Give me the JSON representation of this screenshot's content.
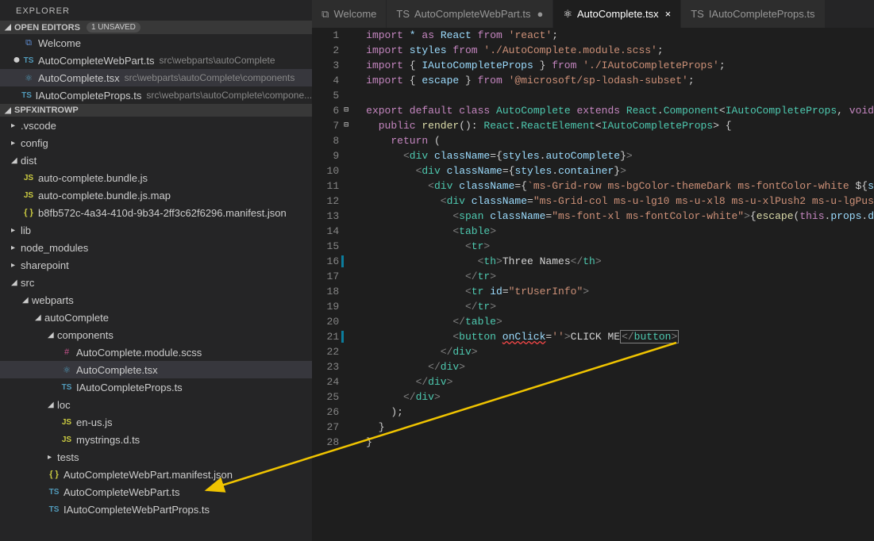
{
  "explorer": {
    "title": "EXPLORER",
    "openEditors": {
      "title": "OPEN EDITORS",
      "badge": "1 UNSAVED",
      "items": [
        {
          "icon": "vs",
          "label": "Welcome",
          "path": "",
          "dirty": false
        },
        {
          "icon": "ts",
          "label": "AutoCompleteWebPart.ts",
          "path": "src\\webparts\\autoComplete",
          "dirty": true
        },
        {
          "icon": "react",
          "label": "AutoComplete.tsx",
          "path": "src\\webparts\\autoComplete\\components",
          "dirty": false,
          "selected": true
        },
        {
          "icon": "ts",
          "label": "IAutoCompleteProps.ts",
          "path": "src\\webparts\\autoComplete\\compone...",
          "dirty": false
        }
      ]
    },
    "workspace": {
      "title": "SPFXINTROWP",
      "tree": [
        {
          "indent": 0,
          "type": "folder",
          "open": false,
          "label": ".vscode"
        },
        {
          "indent": 0,
          "type": "folder",
          "open": false,
          "label": "config"
        },
        {
          "indent": 0,
          "type": "folder",
          "open": true,
          "label": "dist"
        },
        {
          "indent": 1,
          "type": "file",
          "icon": "js",
          "label": "auto-complete.bundle.js"
        },
        {
          "indent": 1,
          "type": "file",
          "icon": "js",
          "label": "auto-complete.bundle.js.map"
        },
        {
          "indent": 1,
          "type": "file",
          "icon": "json",
          "label": "b8fb572c-4a34-410d-9b34-2ff3c62f6296.manifest.json"
        },
        {
          "indent": 0,
          "type": "folder",
          "open": false,
          "label": "lib"
        },
        {
          "indent": 0,
          "type": "folder",
          "open": false,
          "label": "node_modules"
        },
        {
          "indent": 0,
          "type": "folder",
          "open": false,
          "label": "sharepoint"
        },
        {
          "indent": 0,
          "type": "folder",
          "open": true,
          "label": "src"
        },
        {
          "indent": 1,
          "type": "folder",
          "open": true,
          "label": "webparts"
        },
        {
          "indent": 2,
          "type": "folder",
          "open": true,
          "label": "autoComplete"
        },
        {
          "indent": 3,
          "type": "folder",
          "open": true,
          "label": "components"
        },
        {
          "indent": 4,
          "type": "file",
          "icon": "scss",
          "label": "AutoComplete.module.scss"
        },
        {
          "indent": 4,
          "type": "file",
          "icon": "react",
          "label": "AutoComplete.tsx",
          "selected": true
        },
        {
          "indent": 4,
          "type": "file",
          "icon": "ts",
          "label": "IAutoCompleteProps.ts"
        },
        {
          "indent": 3,
          "type": "folder",
          "open": true,
          "label": "loc"
        },
        {
          "indent": 4,
          "type": "file",
          "icon": "js",
          "label": "en-us.js"
        },
        {
          "indent": 4,
          "type": "file",
          "icon": "js",
          "label": "mystrings.d.ts"
        },
        {
          "indent": 3,
          "type": "folder",
          "open": false,
          "label": "tests"
        },
        {
          "indent": 3,
          "type": "file",
          "icon": "json",
          "label": "AutoCompleteWebPart.manifest.json"
        },
        {
          "indent": 3,
          "type": "file",
          "icon": "ts",
          "label": "AutoCompleteWebPart.ts"
        },
        {
          "indent": 3,
          "type": "file",
          "icon": "ts",
          "label": "IAutoCompleteWebPartProps.ts"
        }
      ]
    }
  },
  "tabs": [
    {
      "icon": "vs",
      "label": "Welcome",
      "active": false
    },
    {
      "icon": "ts",
      "label": "AutoCompleteWebPart.ts",
      "active": false,
      "dirty": true
    },
    {
      "icon": "react",
      "label": "AutoComplete.tsx",
      "active": true
    },
    {
      "icon": "ts",
      "label": "IAutoCompleteProps.ts",
      "active": false
    }
  ],
  "code": {
    "lines": [
      {
        "n": 1,
        "html": "<span class='tok-key'>import</span> <span class='tok-var'>*</span> <span class='tok-key'>as</span> <span class='tok-var'>React</span> <span class='tok-key'>from</span> <span class='tok-str'>'react'</span>;"
      },
      {
        "n": 2,
        "html": "<span class='tok-key'>import</span> <span class='tok-var'>styles</span> <span class='tok-key'>from</span> <span class='tok-str'>'./AutoComplete.module.scss'</span>;"
      },
      {
        "n": 3,
        "html": "<span class='tok-key'>import</span> { <span class='tok-var'>IAutoCompleteProps</span> } <span class='tok-key'>from</span> <span class='tok-str'>'./IAutoCompleteProps'</span>;"
      },
      {
        "n": 4,
        "html": "<span class='tok-key'>import</span> { <span class='tok-var'>escape</span> } <span class='tok-key'>from</span> <span class='tok-str'>'@microsoft/sp-lodash-subset'</span>;"
      },
      {
        "n": 5,
        "html": ""
      },
      {
        "n": 6,
        "fold": true,
        "html": "<span class='tok-key'>export</span> <span class='tok-key'>default</span> <span class='tok-key'>class</span> <span class='tok-type'>AutoComplete</span> <span class='tok-key'>extends</span> <span class='tok-type'>React</span>.<span class='tok-type'>Component</span>&lt;<span class='tok-type'>IAutoCompleteProps</span>, <span class='tok-key'>void</span>"
      },
      {
        "n": 7,
        "fold": true,
        "html": "  <span class='tok-key'>public</span> <span class='tok-func'>render</span>(): <span class='tok-type'>React</span>.<span class='tok-type'>ReactElement</span>&lt;<span class='tok-type'>IAutoCompleteProps</span>&gt; {"
      },
      {
        "n": 8,
        "html": "    <span class='tok-key'>return</span> ("
      },
      {
        "n": 9,
        "html": "      <span class='tok-tag'>&lt;</span><span class='tok-comp'>div</span> <span class='tok-attr'>className</span>=<span class='tok-punc'>{</span><span class='tok-var'>styles</span>.<span class='tok-var'>autoComplete</span><span class='tok-punc'>}</span><span class='tok-tag'>&gt;</span>"
      },
      {
        "n": 10,
        "html": "        <span class='tok-tag'>&lt;</span><span class='tok-comp'>div</span> <span class='tok-attr'>className</span>=<span class='tok-punc'>{</span><span class='tok-var'>styles</span>.<span class='tok-var'>container</span><span class='tok-punc'>}</span><span class='tok-tag'>&gt;</span>"
      },
      {
        "n": 11,
        "html": "          <span class='tok-tag'>&lt;</span><span class='tok-comp'>div</span> <span class='tok-attr'>className</span>=<span class='tok-punc'>{</span><span class='tok-str'>`ms-Grid-row ms-bgColor-themeDark ms-fontColor-white </span><span class='tok-punc'>${</span><span class='tok-var'>s</span>"
      },
      {
        "n": 12,
        "html": "            <span class='tok-tag'>&lt;</span><span class='tok-comp'>div</span> <span class='tok-attr'>className</span>=<span class='tok-str'>\"ms-Grid-col ms-u-lg10 ms-u-xl8 ms-u-xlPush2 ms-u-lgPus</span>"
      },
      {
        "n": 13,
        "html": "              <span class='tok-tag'>&lt;</span><span class='tok-comp'>span</span> <span class='tok-attr'>className</span>=<span class='tok-str'>\"ms-font-xl ms-fontColor-white\"</span><span class='tok-tag'>&gt;</span><span class='tok-punc'>{</span><span class='tok-func'>escape</span>(<span class='tok-key'>this</span>.<span class='tok-var'>props</span>.<span class='tok-var'>d</span>"
      },
      {
        "n": 14,
        "html": "              <span class='tok-tag'>&lt;</span><span class='tok-comp'>table</span><span class='tok-tag'>&gt;</span>"
      },
      {
        "n": 15,
        "html": "                <span class='tok-tag'>&lt;</span><span class='tok-comp'>tr</span><span class='tok-tag'>&gt;</span>"
      },
      {
        "n": 16,
        "mod": true,
        "html": "                  <span class='tok-tag'>&lt;</span><span class='tok-comp'>th</span><span class='tok-tag'>&gt;</span><span class='tok-txt'>Three Names</span><span class='tok-tag'>&lt;/</span><span class='tok-comp'>th</span><span class='tok-tag'>&gt;</span>"
      },
      {
        "n": 17,
        "html": "                <span class='tok-tag'>&lt;/</span><span class='tok-comp'>tr</span><span class='tok-tag'>&gt;</span>"
      },
      {
        "n": 18,
        "html": "                <span class='tok-tag'>&lt;</span><span class='tok-comp'>tr</span> <span class='tok-attr'>id</span>=<span class='tok-str'>\"trUserInfo\"</span><span class='tok-tag'>&gt;</span>"
      },
      {
        "n": 19,
        "html": "                <span class='tok-tag'>&lt;/</span><span class='tok-comp'>tr</span><span class='tok-tag'>&gt;</span>"
      },
      {
        "n": 20,
        "html": "              <span class='tok-tag'>&lt;/</span><span class='tok-comp'>table</span><span class='tok-tag'>&gt;</span>"
      },
      {
        "n": 21,
        "mod": true,
        "html": "              <span class='tok-tag'>&lt;</span><span class='tok-comp'>button</span> <span class='tok-attr squiggle'>onClick</span>=<span class='tok-str'>''</span><span class='tok-tag'>&gt;</span><span class='tok-txt'>CLICK ME</span><span class='sel-box'><span class='tok-tag'>&lt;/</span><span class='tok-comp'>button</span><span class='tok-tag'>&gt;</span></span>"
      },
      {
        "n": 22,
        "html": "            <span class='tok-tag'>&lt;/</span><span class='tok-comp'>div</span><span class='tok-tag'>&gt;</span>"
      },
      {
        "n": 23,
        "html": "          <span class='tok-tag'>&lt;/</span><span class='tok-comp'>div</span><span class='tok-tag'>&gt;</span>"
      },
      {
        "n": 24,
        "html": "        <span class='tok-tag'>&lt;/</span><span class='tok-comp'>div</span><span class='tok-tag'>&gt;</span>"
      },
      {
        "n": 25,
        "html": "      <span class='tok-tag'>&lt;/</span><span class='tok-comp'>div</span><span class='tok-tag'>&gt;</span>"
      },
      {
        "n": 26,
        "html": "    );"
      },
      {
        "n": 27,
        "html": "  }"
      },
      {
        "n": 28,
        "html": "}"
      }
    ]
  },
  "iconGlyphs": {
    "vs": "⧉",
    "ts": "TS",
    "react": "⚛",
    "js": "JS",
    "json": "{ }",
    "scss": "#"
  }
}
